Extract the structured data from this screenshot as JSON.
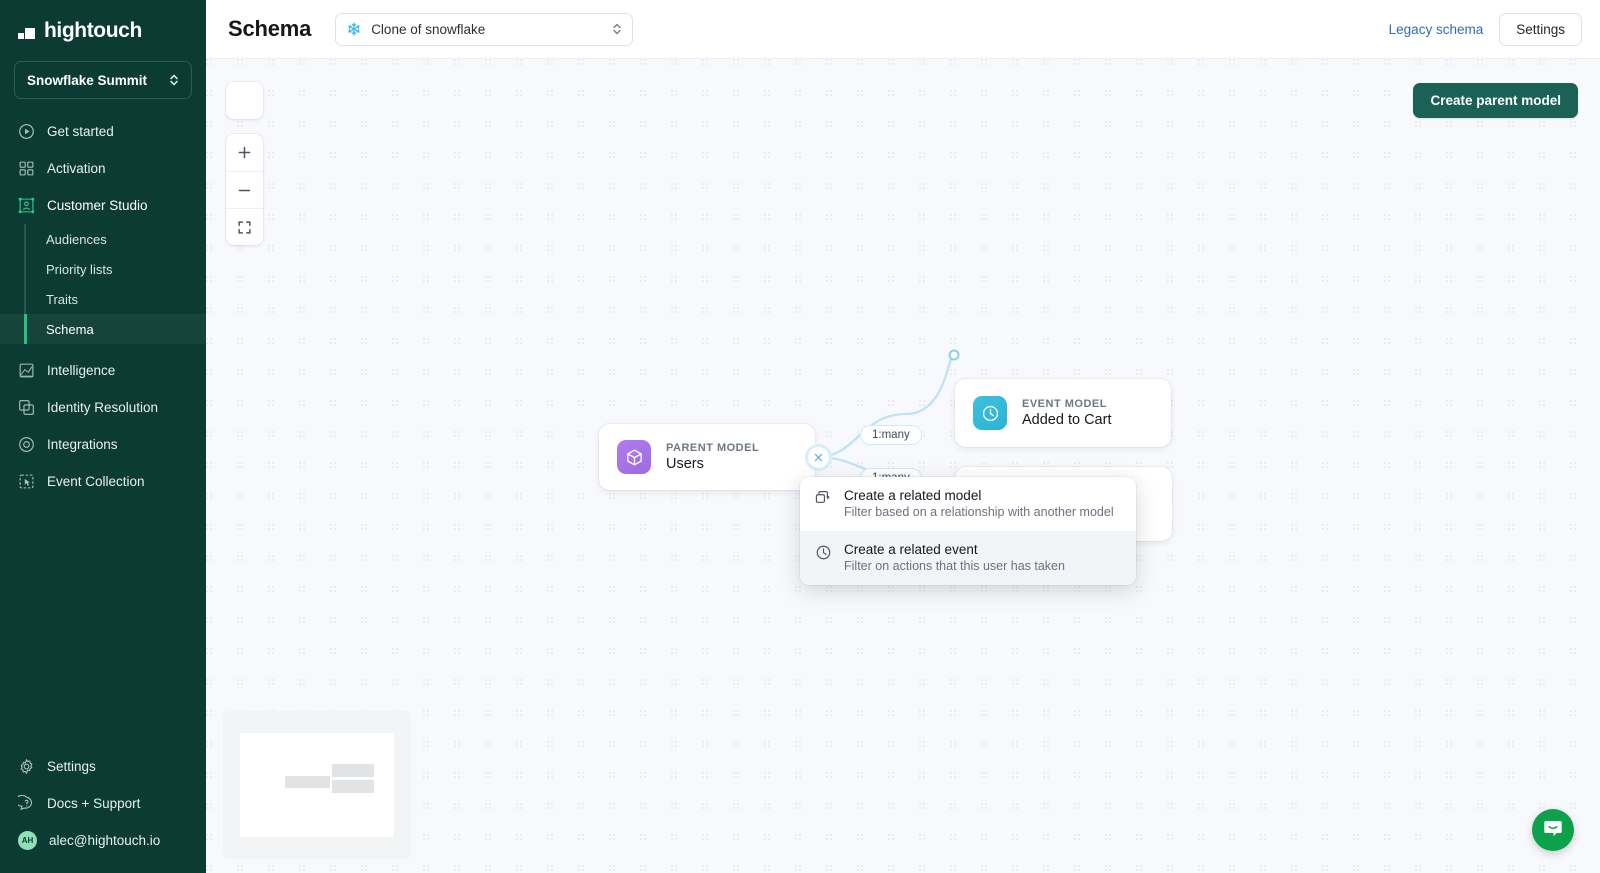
{
  "brand": {
    "name": "hightouch",
    "accent": "#25c183",
    "sidebar_bg": "#0c3b33"
  },
  "sidebar": {
    "workspace": "Snowflake Summit",
    "items": [
      {
        "label": "Get started",
        "icon": "play-circle-icon"
      },
      {
        "label": "Activation",
        "icon": "grid-squares-icon"
      },
      {
        "label": "Customer Studio",
        "icon": "customer-studio-icon"
      }
    ],
    "sub_items": [
      {
        "label": "Audiences"
      },
      {
        "label": "Priority lists"
      },
      {
        "label": "Traits"
      },
      {
        "label": "Schema",
        "selected": true
      }
    ],
    "items_after": [
      {
        "label": "Intelligence",
        "icon": "chart-area-icon"
      },
      {
        "label": "Identity Resolution",
        "icon": "identity-icon"
      },
      {
        "label": "Integrations",
        "icon": "integrations-icon"
      },
      {
        "label": "Event Collection",
        "icon": "event-collection-icon"
      }
    ],
    "bottom_items": [
      {
        "label": "Settings",
        "icon": "gear-icon"
      },
      {
        "label": "Docs + Support",
        "icon": "question-bubble-icon"
      }
    ],
    "user": {
      "email": "alec@hightouch.io",
      "initials": "AH"
    }
  },
  "header": {
    "title": "Schema",
    "source_select": {
      "value": "Clone of snowflake",
      "icon": "snowflake-icon"
    },
    "legacy_link": "Legacy schema",
    "settings_button": "Settings"
  },
  "canvas": {
    "search_icon": "search-icon",
    "zoom_in_icon": "plus-icon",
    "zoom_out_icon": "minus-icon",
    "fit_view_icon": "fit-view-icon",
    "create_parent_button": "Create parent model",
    "nodes": [
      {
        "kind": "PARENT MODEL",
        "name": "Users",
        "icon": "cube-icon",
        "type": "parent"
      },
      {
        "kind": "EVENT MODEL",
        "name": "Added to Cart",
        "icon": "clock-icon",
        "type": "event"
      }
    ],
    "edge_labels": [
      "1:many",
      "1:many"
    ],
    "handle_icon": "plus-handle-icon"
  },
  "context_menu": {
    "items": [
      {
        "title": "Create a related model",
        "subtitle": "Filter based on a relationship with another model",
        "icon": "stacked-layers-icon",
        "hovered": false
      },
      {
        "title": "Create a related event",
        "subtitle": "Filter on actions that this user has taken",
        "icon": "clock-icon",
        "hovered": true
      }
    ]
  },
  "support": {
    "chat_icon": "intercom-chat-icon"
  }
}
